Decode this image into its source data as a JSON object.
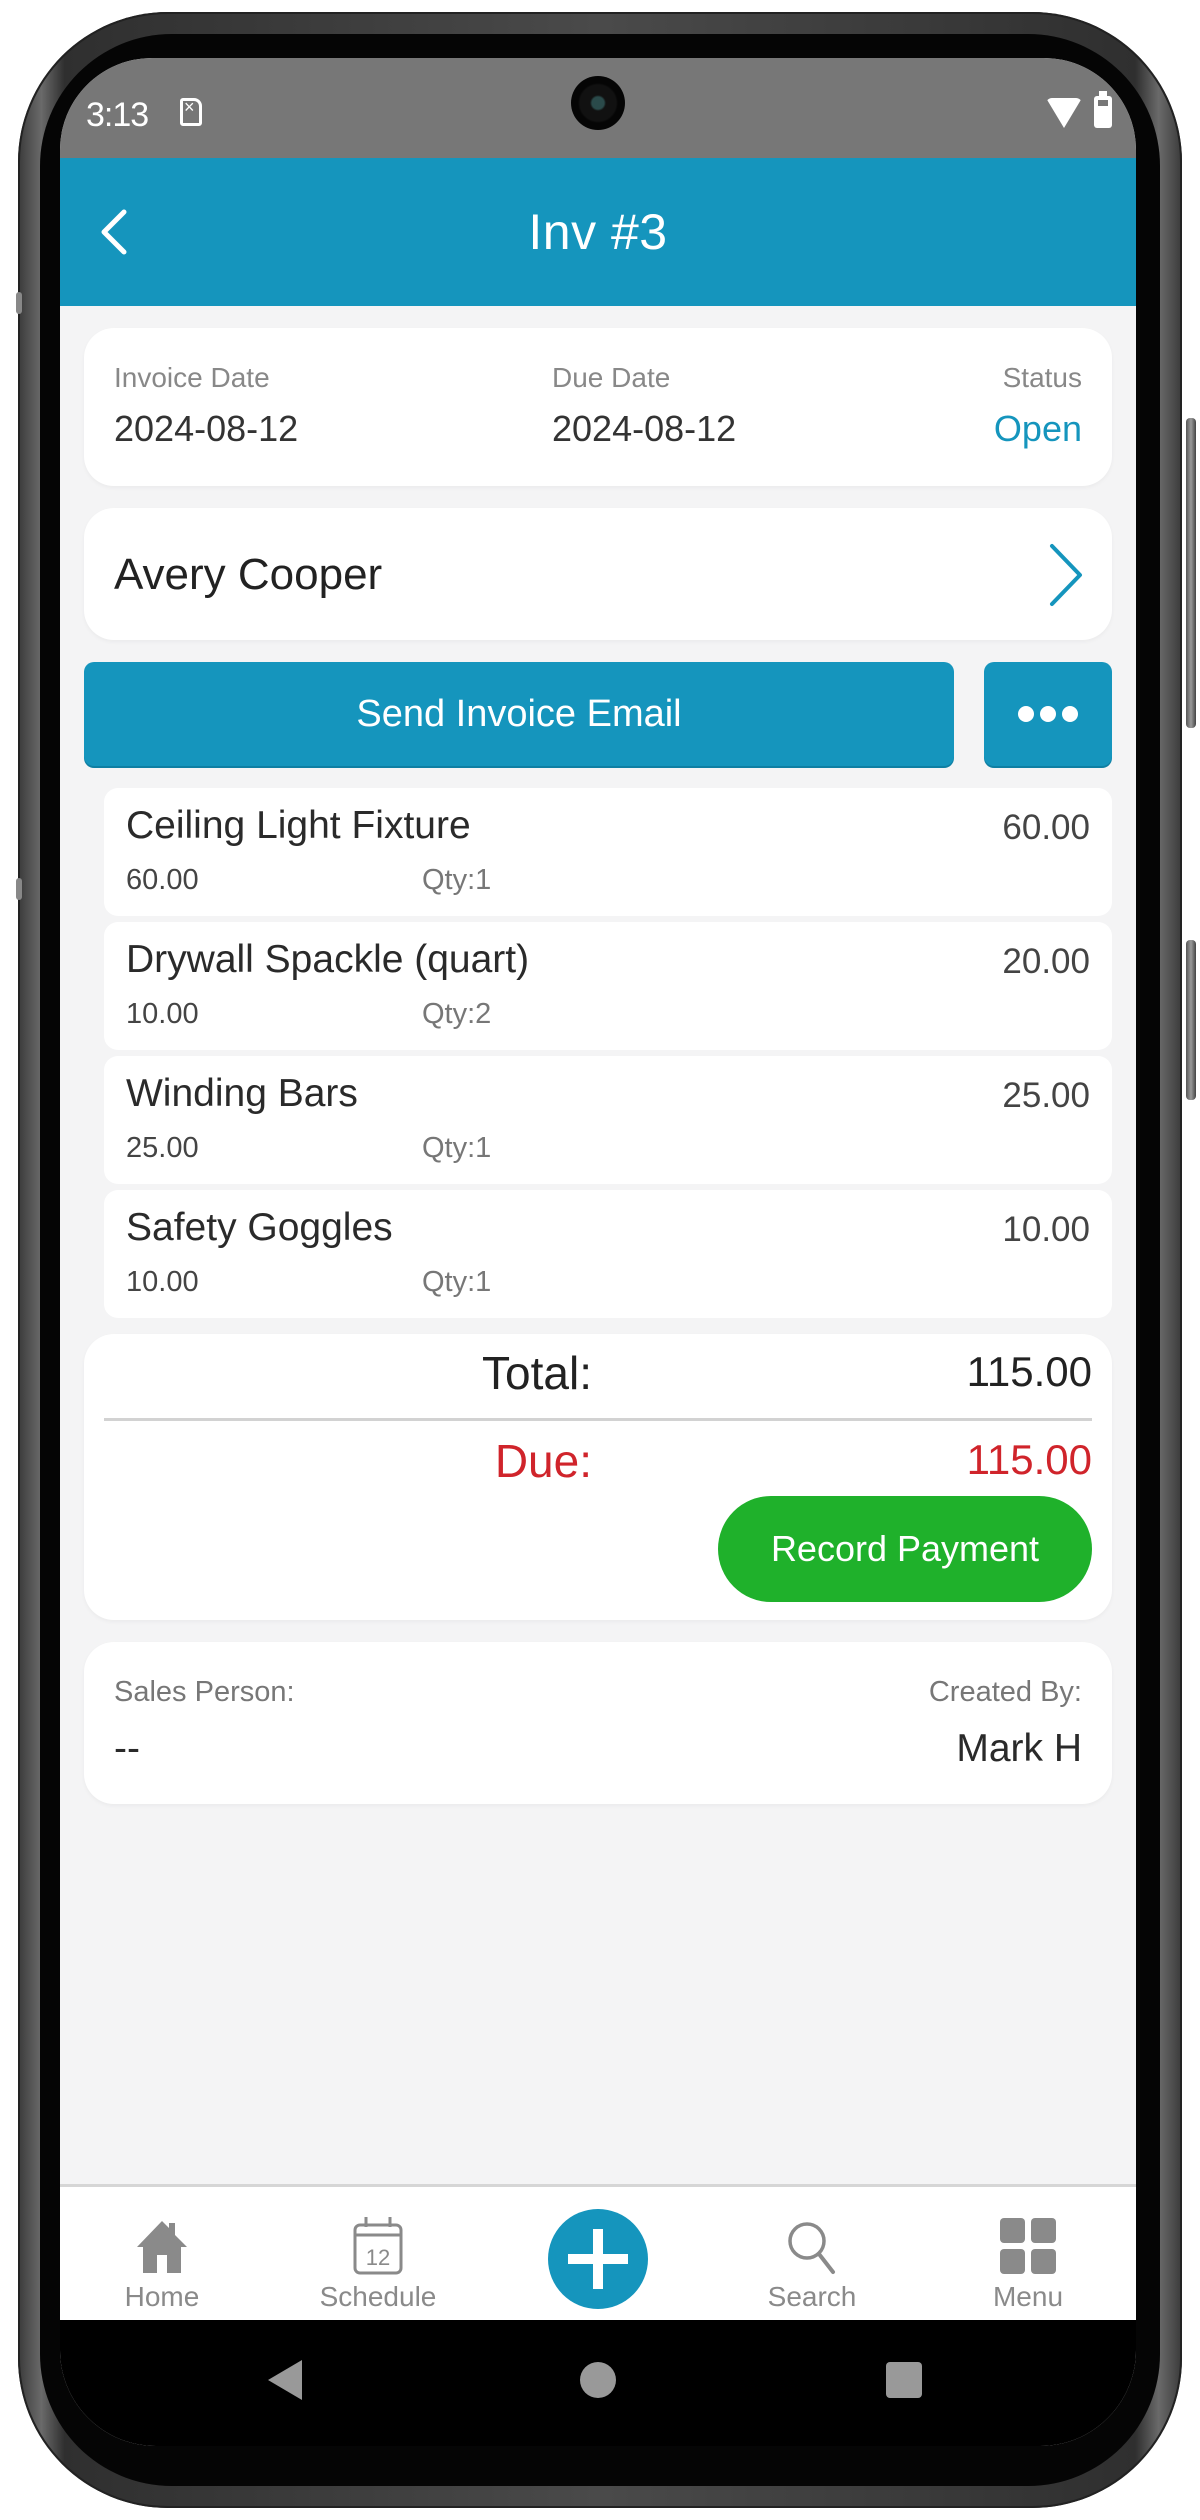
{
  "status_bar": {
    "time": "3:13",
    "icons": [
      "sim-error-icon",
      "wifi-icon",
      "battery-icon"
    ]
  },
  "header": {
    "title": "Inv #3",
    "back_icon": "chevron-left-icon"
  },
  "invoice_info": {
    "invoice_date_label": "Invoice Date",
    "invoice_date": "2024-08-12",
    "due_date_label": "Due Date",
    "due_date": "2024-08-12",
    "status_label": "Status",
    "status": "Open"
  },
  "customer": {
    "name": "Avery Cooper",
    "chevron_icon": "chevron-right-icon"
  },
  "actions": {
    "send_email_label": "Send Invoice Email",
    "more_icon": "more-horizontal-icon"
  },
  "line_items": [
    {
      "name": "Ceiling Light Fixture",
      "amount": "60.00",
      "unit_price": "60.00",
      "qty": "Qty:1"
    },
    {
      "name": "Drywall Spackle (quart)",
      "amount": "20.00",
      "unit_price": "10.00",
      "qty": "Qty:2"
    },
    {
      "name": "Winding Bars",
      "amount": "25.00",
      "unit_price": "25.00",
      "qty": "Qty:1"
    },
    {
      "name": "Safety Goggles",
      "amount": "10.00",
      "unit_price": "10.00",
      "qty": "Qty:1"
    }
  ],
  "totals": {
    "total_label": "Total:",
    "total_value": "115.00",
    "due_label": "Due:",
    "due_value": "115.00",
    "record_payment_label": "Record Payment"
  },
  "meta": {
    "sales_person_label": "Sales Person:",
    "sales_person": "--",
    "created_by_label": "Created By:",
    "created_by": "Mark H"
  },
  "tab_bar": {
    "items": [
      {
        "label": "Home",
        "icon": "home-icon"
      },
      {
        "label": "Schedule",
        "icon": "calendar-icon",
        "icon_text": "12"
      },
      {
        "label": "",
        "icon": "add-icon"
      },
      {
        "label": "Search",
        "icon": "search-icon"
      },
      {
        "label": "Menu",
        "icon": "grid-icon"
      }
    ]
  },
  "colors": {
    "primary": "#1595bd",
    "due_red": "#d0242b",
    "success_green": "#1fb12b",
    "background": "#f4f4f5"
  }
}
